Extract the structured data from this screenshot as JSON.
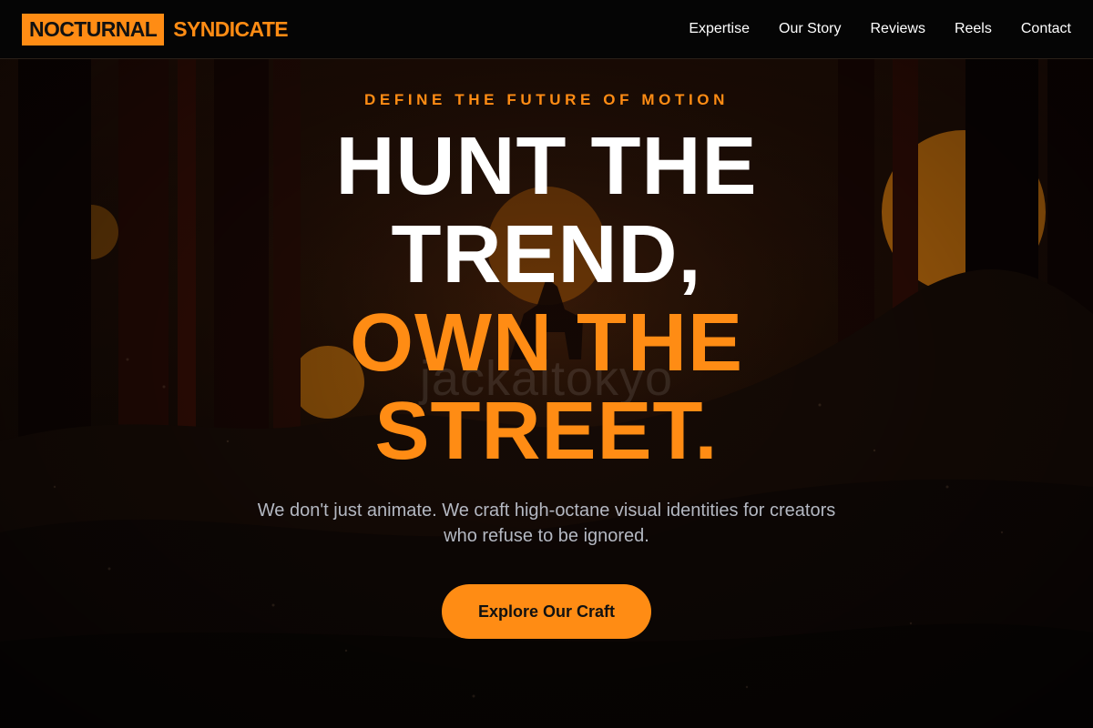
{
  "header": {
    "logo_primary": "NOCTURNAL",
    "logo_secondary": "SYNDICATE",
    "nav": [
      "Expertise",
      "Our Story",
      "Reviews",
      "Reels",
      "Contact"
    ]
  },
  "hero": {
    "eyebrow": "DEFINE THE FUTURE OF MOTION",
    "headline_line1": "HUNT THE",
    "headline_line2": "TREND,",
    "headline_line3": "OWN THE",
    "headline_line4": "STREET.",
    "subtext": "We don't just animate. We craft high-octane visual identities for creators who refuse to be ignored.",
    "cta_label": "Explore Our Craft",
    "watermark": "jackaltokyo"
  },
  "colors": {
    "accent": "#ff8c14",
    "header_bg": "#050505",
    "subtext": "#b4b8c2"
  }
}
